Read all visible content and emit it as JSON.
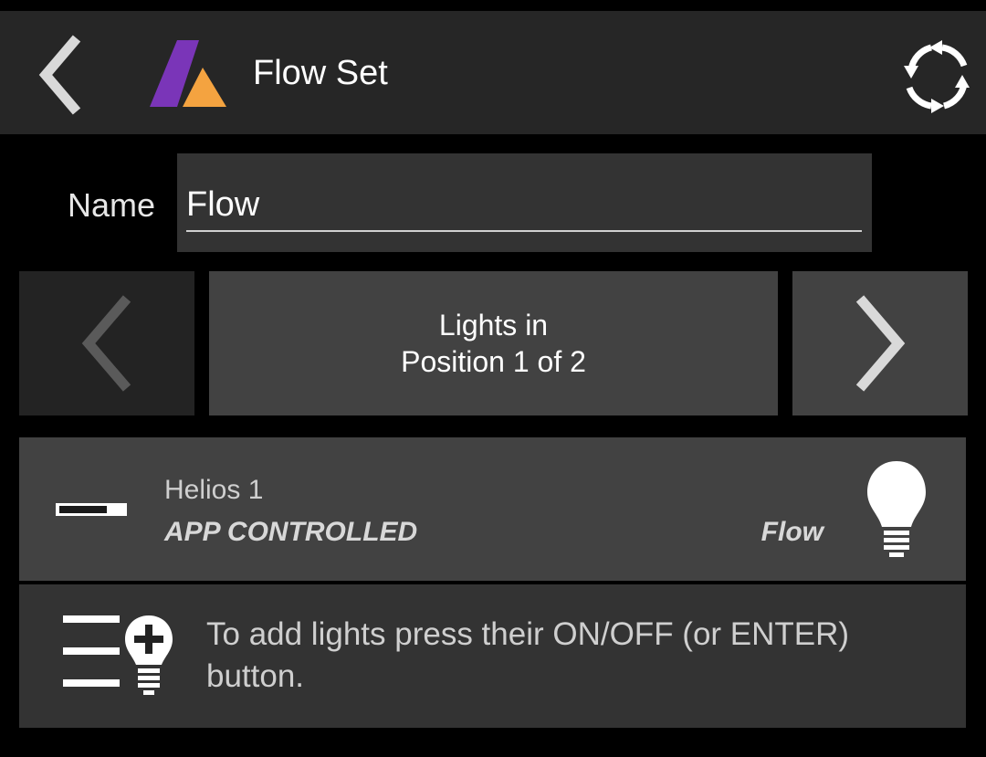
{
  "header": {
    "title": "Flow Set",
    "back_icon": "chevron-left-icon",
    "logo_icon": "app-logo-icon",
    "refresh_icon": "refresh-icon"
  },
  "form": {
    "name_label": "Name",
    "name_value": "Flow"
  },
  "position_nav": {
    "line1": "Lights in",
    "line2": "Position 1 of 2",
    "prev_icon": "chevron-left-icon",
    "next_icon": "chevron-right-icon"
  },
  "lights": [
    {
      "name": "Helios 1",
      "mode": "APP CONTROLLED",
      "effect": "Flow",
      "icon": "lightbulb-icon"
    }
  ],
  "hint": {
    "text": "To add lights press their ON/OFF (or ENTER) button.",
    "icon": "add-light-icon"
  },
  "colors": {
    "background": "#000000",
    "appbar": "#262626",
    "panel": "#424242",
    "panel_dark": "#333333",
    "logo_purple": "#7a35b8",
    "logo_orange": "#f4a340"
  }
}
